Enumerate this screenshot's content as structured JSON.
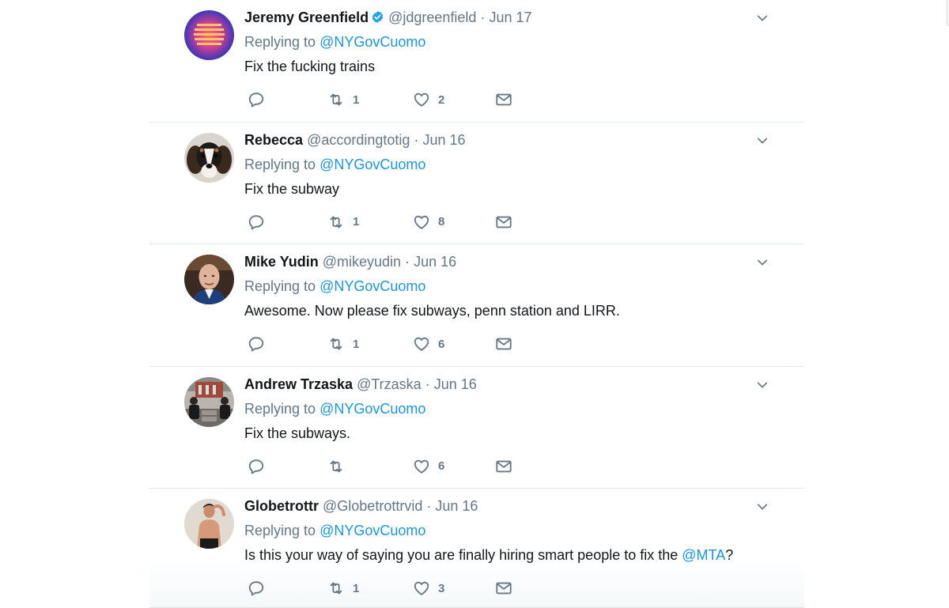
{
  "tweets": [
    {
      "fullname": "Jeremy Greenfield",
      "verified": true,
      "username": "@jdgreenfield",
      "separator": "·",
      "time": "Jun 17",
      "replying_prefix": "Replying to",
      "replying_to": "@NYGovCuomo",
      "text": "Fix the fucking trains",
      "text_mention": "",
      "text_suffix": "",
      "retweets": "1",
      "likes": "2"
    },
    {
      "fullname": "Rebecca",
      "verified": false,
      "username": "@accordingtotig",
      "separator": "·",
      "time": "Jun 16",
      "replying_prefix": "Replying to",
      "replying_to": "@NYGovCuomo",
      "text": "Fix the subway",
      "text_mention": "",
      "text_suffix": "",
      "retweets": "1",
      "likes": "8"
    },
    {
      "fullname": "Mike Yudin",
      "verified": false,
      "username": "@mikeyudin",
      "separator": "·",
      "time": "Jun 16",
      "replying_prefix": "Replying to",
      "replying_to": "@NYGovCuomo",
      "text": "Awesome. Now please fix subways, penn station and LIRR.",
      "text_mention": "",
      "text_suffix": "",
      "retweets": "1",
      "likes": "6"
    },
    {
      "fullname": "Andrew Trzaska",
      "verified": false,
      "username": "@Trzaska",
      "separator": "·",
      "time": "Jun 16",
      "replying_prefix": "Replying to",
      "replying_to": "@NYGovCuomo",
      "text": "Fix the subways.",
      "text_mention": "",
      "text_suffix": "",
      "retweets": "",
      "likes": "6"
    },
    {
      "fullname": "Globetrottr",
      "verified": false,
      "username": "@Globetrottrvid",
      "separator": "·",
      "time": "Jun 16",
      "replying_prefix": "Replying to",
      "replying_to": "@NYGovCuomo",
      "text": "Is this your way of saying you are finally hiring smart people to fix the ",
      "text_mention": "@MTA",
      "text_suffix": "?",
      "retweets": "1",
      "likes": "3"
    }
  ],
  "icons": {
    "reply": "reply-icon",
    "retweet": "retweet-icon",
    "like": "heart-icon",
    "dm": "envelope-icon",
    "caret": "chevron-down-icon",
    "verified": "verified-badge-icon"
  },
  "colors": {
    "text": "#14171a",
    "secondary": "#657786",
    "link": "#1b95e0",
    "divider": "#e1e8ed",
    "verified": "#1da1f2"
  }
}
